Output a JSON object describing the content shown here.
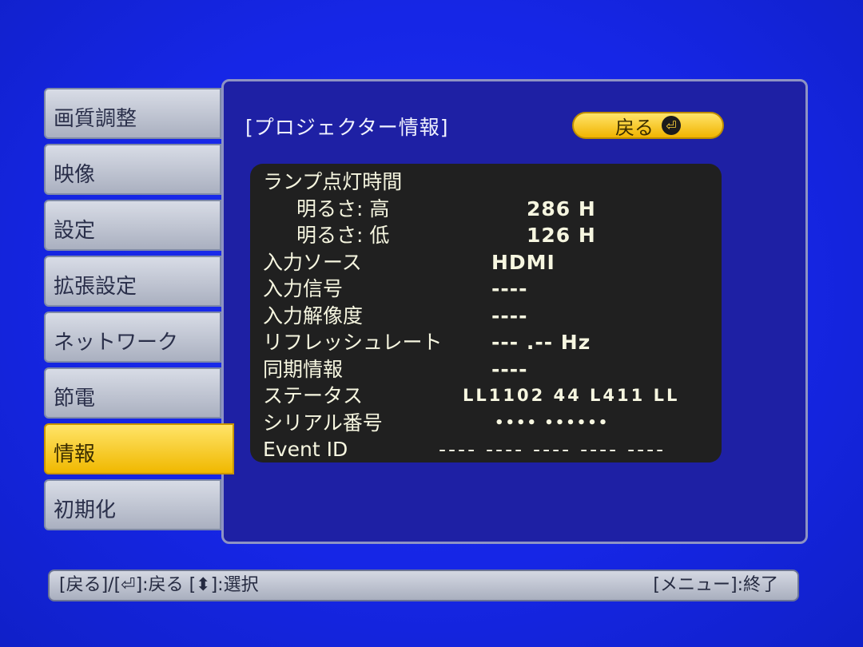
{
  "sidebar": {
    "items": [
      {
        "label": "画質調整"
      },
      {
        "label": "映像"
      },
      {
        "label": "設定"
      },
      {
        "label": "拡張設定"
      },
      {
        "label": "ネットワーク"
      },
      {
        "label": "節電"
      },
      {
        "label": "情報",
        "selected": true
      },
      {
        "label": "初期化"
      }
    ]
  },
  "panel": {
    "title": "[プロジェクター情報]",
    "back_label": "戻る",
    "back_icon": "enter-icon",
    "rows": [
      {
        "label": "ランプ点灯時間",
        "value": ""
      },
      {
        "label": "明るさ: 高",
        "value": "286 H"
      },
      {
        "label": "明るさ: 低",
        "value": "126 H"
      },
      {
        "label": "入力ソース",
        "value": "HDMI"
      },
      {
        "label": "入力信号",
        "value": "----"
      },
      {
        "label": "入力解像度",
        "value": "----"
      },
      {
        "label": "リフレッシュレート",
        "value": "--- .-- Hz"
      },
      {
        "label": "同期情報",
        "value": "----"
      },
      {
        "label": "ステータス",
        "value": "LL1102 44 L411 LL"
      },
      {
        "label": "シリアル番号",
        "value": "•••• ••••••"
      },
      {
        "label": "Event ID",
        "value": "---- ---- ---- ---- ----"
      }
    ]
  },
  "footer": {
    "left": "[戻る]/[⏎]:戻る [⬍]:選択",
    "right": "[メニュー]:終了"
  },
  "colors": {
    "background": "#1626e6",
    "panel": "#1e20a4",
    "accent": "#f0b800",
    "info_box": "#202020"
  }
}
